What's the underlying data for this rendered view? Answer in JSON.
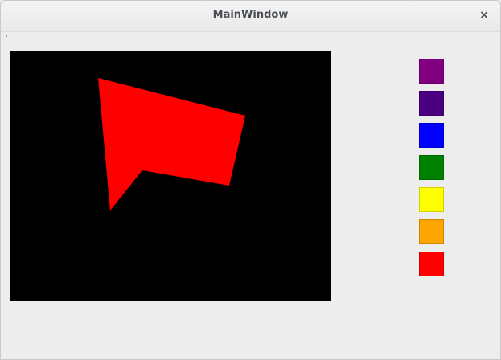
{
  "window": {
    "title": "MainWindow",
    "close_glyph": "×"
  },
  "canvas": {
    "background": "#000000",
    "shape_color": "#ff0000",
    "shape_icon": "polygon-shape"
  },
  "palette": {
    "colors": [
      {
        "name": "purple",
        "hex": "#800080"
      },
      {
        "name": "indigo",
        "hex": "#4b0082"
      },
      {
        "name": "blue",
        "hex": "#0000ff"
      },
      {
        "name": "green",
        "hex": "#008000"
      },
      {
        "name": "yellow",
        "hex": "#ffff00"
      },
      {
        "name": "orange",
        "hex": "#ffa500"
      },
      {
        "name": "red",
        "hex": "#ff0000"
      }
    ]
  }
}
